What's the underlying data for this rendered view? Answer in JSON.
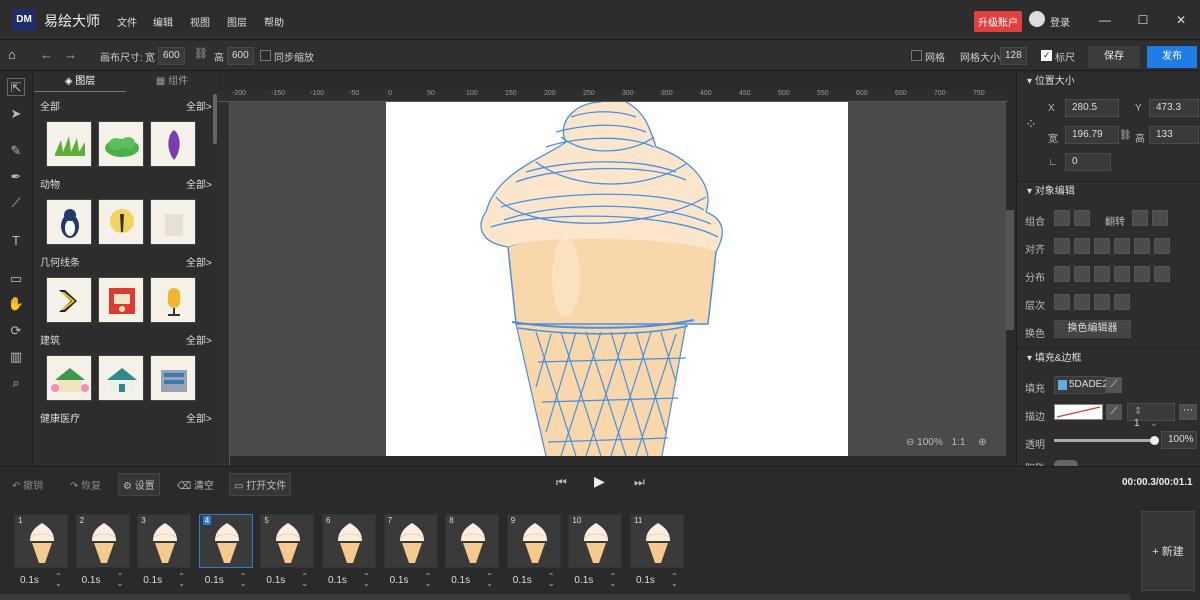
{
  "app": {
    "logo": "DM",
    "name": "易绘大师",
    "menus": [
      "文件",
      "编辑",
      "视图",
      "图层",
      "帮助"
    ],
    "upgrade": "升级账户",
    "login": "登录"
  },
  "toolbar": {
    "canvas_size_label": "画布尺寸:",
    "width_label": "宽",
    "width_value": "600",
    "height_label": "高",
    "height_value": "600",
    "sync_scale_label": "同步缩放",
    "grid_label": "网格",
    "grid_size_label": "网格大小",
    "grid_size_value": "128",
    "ruler_label": "标尺",
    "save": "保存",
    "publish": "发布"
  },
  "assets": {
    "tabs": [
      "图层",
      "组件"
    ],
    "categories": [
      {
        "name": "全部",
        "more": "全部>"
      },
      {
        "name": "动物",
        "more": "全部>"
      },
      {
        "name": "几何线条",
        "more": "全部>"
      },
      {
        "name": "建筑",
        "more": "全部>"
      },
      {
        "name": "健康医疗",
        "more": "全部>"
      }
    ]
  },
  "ruler": {
    "labels": [
      "-200",
      "-150",
      "-100",
      "-50",
      "0",
      "50",
      "100",
      "150",
      "200",
      "250",
      "300",
      "350",
      "400",
      "450",
      "500",
      "550",
      "600",
      "650",
      "700",
      "750"
    ]
  },
  "zoom": {
    "value": "100%",
    "ratio": "1:1"
  },
  "props": {
    "position": {
      "title": "位置大小",
      "x_label": "X",
      "x": "280.5",
      "y_label": "Y",
      "y": "473.3",
      "w_label": "宽",
      "w": "196.79",
      "h_label": "高",
      "h": "133",
      "angle": "0"
    },
    "object": {
      "title": "对象编辑",
      "group": "组合",
      "flip": "翻转",
      "align": "对齐",
      "distribute": "分布",
      "layer": "层次",
      "recolor": "换色",
      "recolor_btn": "换色编辑器"
    },
    "fill": {
      "title": "填充&边框",
      "fill_label": "填充",
      "fill_value": "5DADE2",
      "fill_color": "#5DADE2",
      "stroke_label": "描边",
      "stroke_width": "1",
      "opacity_label": "透明",
      "opacity_value": "100%",
      "opacity_level": 1.0,
      "shadow_label": "阴影"
    }
  },
  "timeline": {
    "undo": "撤销",
    "redo": "恢复",
    "settings": "设置",
    "clear": "清空",
    "open": "打开文件",
    "time": "00:00.3/00:01.1",
    "new": "新建",
    "frames": [
      {
        "n": "1",
        "t": "0.1s"
      },
      {
        "n": "2",
        "t": "0.1s"
      },
      {
        "n": "3",
        "t": "0.1s"
      },
      {
        "n": "4",
        "t": "0.1s"
      },
      {
        "n": "5",
        "t": "0.1s"
      },
      {
        "n": "6",
        "t": "0.1s"
      },
      {
        "n": "7",
        "t": "0.1s"
      },
      {
        "n": "8",
        "t": "0.1s"
      },
      {
        "n": "9",
        "t": "0.1s"
      },
      {
        "n": "10",
        "t": "0.1s"
      },
      {
        "n": "11",
        "t": "0.1s"
      }
    ],
    "selected_frame": "4"
  }
}
